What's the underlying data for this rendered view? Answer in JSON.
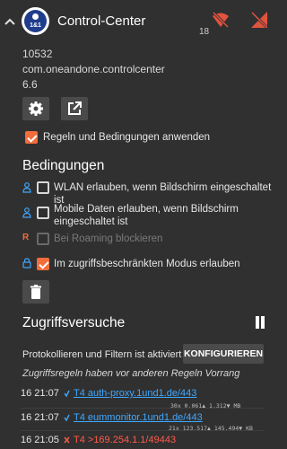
{
  "header": {
    "title": "Control-Center",
    "logo_text": "1&1",
    "count": "18"
  },
  "app": {
    "uid": "10532",
    "package": "com.oneandone.controlcenter",
    "version": "6.6"
  },
  "apply_rules": {
    "label": "Regeln und Bedingungen anwenden",
    "checked": true
  },
  "conditions": {
    "heading": "Bedingungen",
    "items": [
      {
        "label": "WLAN erlauben, wenn Bildschirm eingeschaltet ist",
        "checked": false,
        "icon": "person-icon"
      },
      {
        "label": "Mobile Daten erlauben, wenn Bildschirm",
        "label2": "eingeschaltet ist",
        "checked": false,
        "icon": "person-icon"
      },
      {
        "label": "Bei Roaming blockieren",
        "checked": false,
        "disabled": true,
        "icon": "R"
      },
      {
        "label": "Im zugriffsbeschränkten Modus erlauben",
        "checked": true,
        "icon": "lock-icon"
      }
    ]
  },
  "access": {
    "heading": "Zugriffsversuche",
    "log_status": "Protokollieren und Filtern ist aktiviert",
    "configure_label": "KONFIGURIEREN",
    "note": "Zugriffsregeln haben vor anderen Regeln Vorrang",
    "rows": [
      {
        "time": "16 21:07",
        "target": "T4 auth-proxy.1und1.de/443",
        "stats": "30x   0,061▲   1,312▼ MB"
      },
      {
        "time": "16 21:07",
        "target": "T4 eummonitor.1und1.de/443",
        "stats": "21x 123,517▲ 145,494▼ KB"
      },
      {
        "time": "16 21:05",
        "target": "T4 >169.254.1.1/49443",
        "stats": ""
      }
    ]
  },
  "colors": {
    "background": "#303030",
    "accent": "#f16d3b",
    "link": "#3fa8ff",
    "blocked": "#ff5a4a",
    "icon_red": "#e0533f",
    "icon_blue": "#3fa8ff"
  }
}
